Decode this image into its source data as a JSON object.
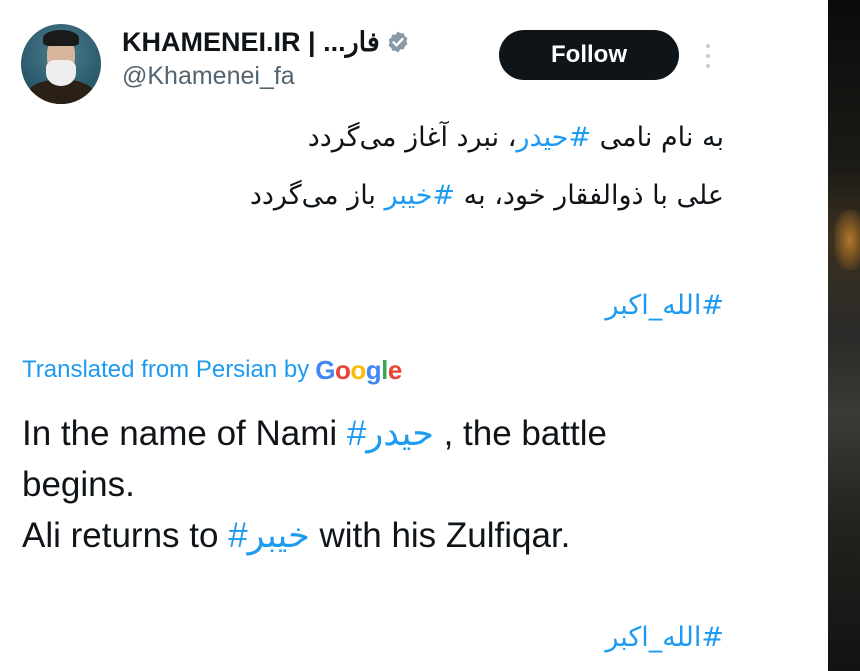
{
  "tweet": {
    "display_name": "KHAMENEI.IR | ...فار",
    "handle": "@Khamenei_fa",
    "follow_label": "Follow",
    "persian_line1_a": "به نام نامی ",
    "persian_line1_hashtag": "#حیدر",
    "persian_line1_b": "، نبرد آغاز می‌گردد",
    "persian_line2_a": "علی با ذوالفقار خود، به ",
    "persian_line2_hashtag": "#خیبر",
    "persian_line2_b": " باز می‌گردد",
    "hashtag_allahu_akbar": "#الله_اکبر",
    "translated_prefix": "Translated from Persian by",
    "translated_brand": "Google",
    "en_line1_a": "In the name of Nami ",
    "en_line1_hashtag": "#حیدر",
    "en_line1_b": " , the battle",
    "en_line2": "begins.",
    "en_line3_a": "Ali returns to ",
    "en_line3_hashtag": "#خیبر",
    "en_line3_b": " with his Zulfiqar.",
    "hashtag_allahu_akbar_2": "#الله_اکبر"
  },
  "icons": {
    "verified": "verified-badge-icon",
    "more": "more-vertical-icon"
  },
  "colors": {
    "link": "#1d9bf0",
    "text": "#0f1419",
    "secondary": "#536471",
    "button": "#0f1419",
    "google_blue": "#4285F4",
    "google_red": "#EA4335",
    "google_yellow": "#FBBC05",
    "google_green": "#34A853"
  }
}
